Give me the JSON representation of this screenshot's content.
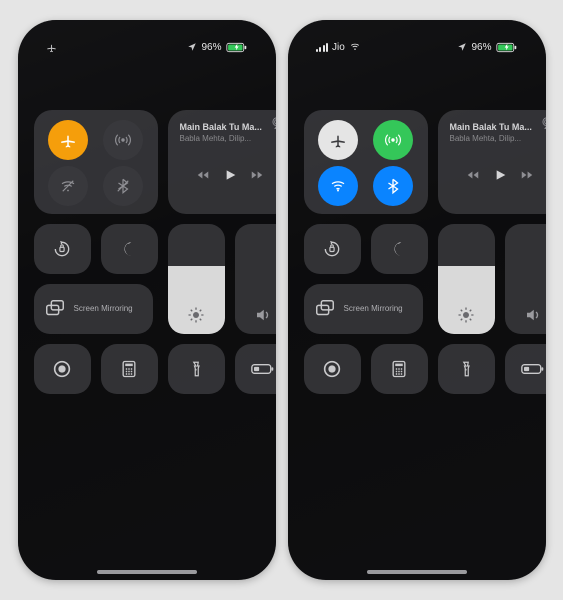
{
  "screens": [
    {
      "status": {
        "left_carrier": "",
        "left_airplane": true,
        "right_battery": "96%",
        "charging": true,
        "location": true,
        "signal": false,
        "wifi": false
      },
      "connectivity": {
        "airplane": {
          "on": true,
          "color": "orange"
        },
        "cellular": {
          "on": false,
          "color": "dim"
        },
        "wifi": {
          "on": false,
          "color": "dim"
        },
        "bluetooth": {
          "on": false,
          "color": "dim"
        }
      },
      "music": {
        "title": "Main Balak Tu Ma...",
        "artist": "Babla Mehta, Dilip..."
      },
      "screen_mirror_label": "Screen\nMirroring",
      "brightness_pct": 62,
      "volume_pct": 0
    },
    {
      "status": {
        "left_carrier": "Jio",
        "left_airplane": false,
        "right_battery": "96%",
        "charging": true,
        "location": true,
        "signal": true,
        "wifi": true
      },
      "connectivity": {
        "airplane": {
          "on": false,
          "color": "white"
        },
        "cellular": {
          "on": true,
          "color": "green"
        },
        "wifi": {
          "on": true,
          "color": "blue"
        },
        "bluetooth": {
          "on": true,
          "color": "blue"
        }
      },
      "music": {
        "title": "Main Balak Tu Ma...",
        "artist": "Babla Mehta, Dilip..."
      },
      "screen_mirror_label": "Screen\nMirroring",
      "brightness_pct": 62,
      "volume_pct": 0
    }
  ],
  "icon_labels": {
    "rotation_lock": "Rotation Lock",
    "dnd": "Do Not Disturb",
    "screen_record": "Screen Record",
    "calculator": "Calculator",
    "flashlight": "Flashlight",
    "low_power": "Low Power Mode"
  }
}
